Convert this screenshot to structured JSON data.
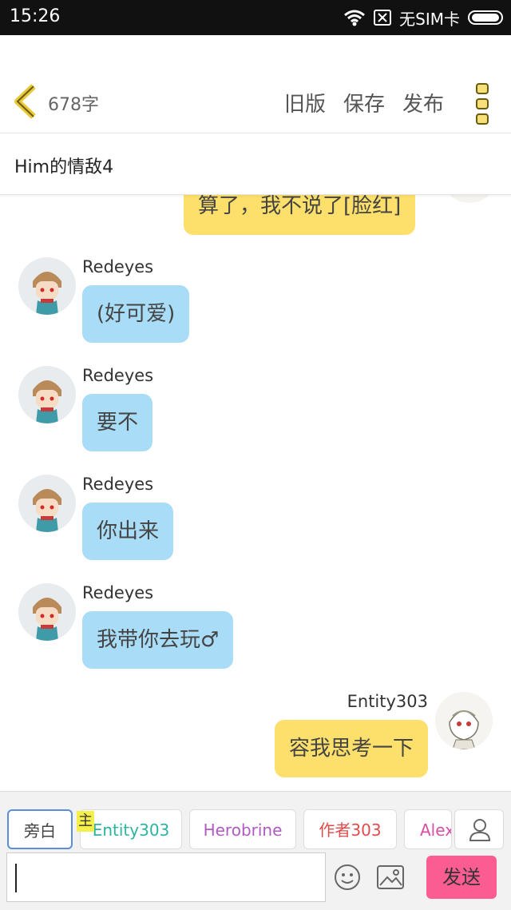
{
  "status_bar": {
    "time": "15:26",
    "carrier": "无SIM卡"
  },
  "header": {
    "word_count": "678字",
    "old_version": "旧版",
    "save": "保存",
    "publish": "发布"
  },
  "story": {
    "title": "Him的情敌4"
  },
  "messages": [
    {
      "side": "right",
      "text": "算了，我不说了[脸红]"
    },
    {
      "side": "left",
      "sender": "Redeyes",
      "text": "(好可爱)"
    },
    {
      "side": "left",
      "sender": "Redeyes",
      "text": "要不"
    },
    {
      "side": "left",
      "sender": "Redeyes",
      "text": "你出来"
    },
    {
      "side": "left",
      "sender": "Redeyes",
      "text": "我带你去玩♂"
    },
    {
      "side": "right",
      "sender": "Entity303",
      "text": "容我思考一下"
    }
  ],
  "roles": [
    {
      "label": "旁白",
      "color": "#444444"
    },
    {
      "label": "Entity303",
      "color": "#2bb5a0",
      "main_tag": "主"
    },
    {
      "label": "Herobrine",
      "color": "#b05ac4"
    },
    {
      "label": "作者303",
      "color": "#e24b4b"
    },
    {
      "label": "Alex",
      "color": "#d94fa3"
    }
  ],
  "composer": {
    "send_label": "发送"
  },
  "colors": {
    "accent_yellow": "#fddf6b",
    "bubble_blue": "#a8dcf7",
    "send_pink": "#fb5d92"
  }
}
